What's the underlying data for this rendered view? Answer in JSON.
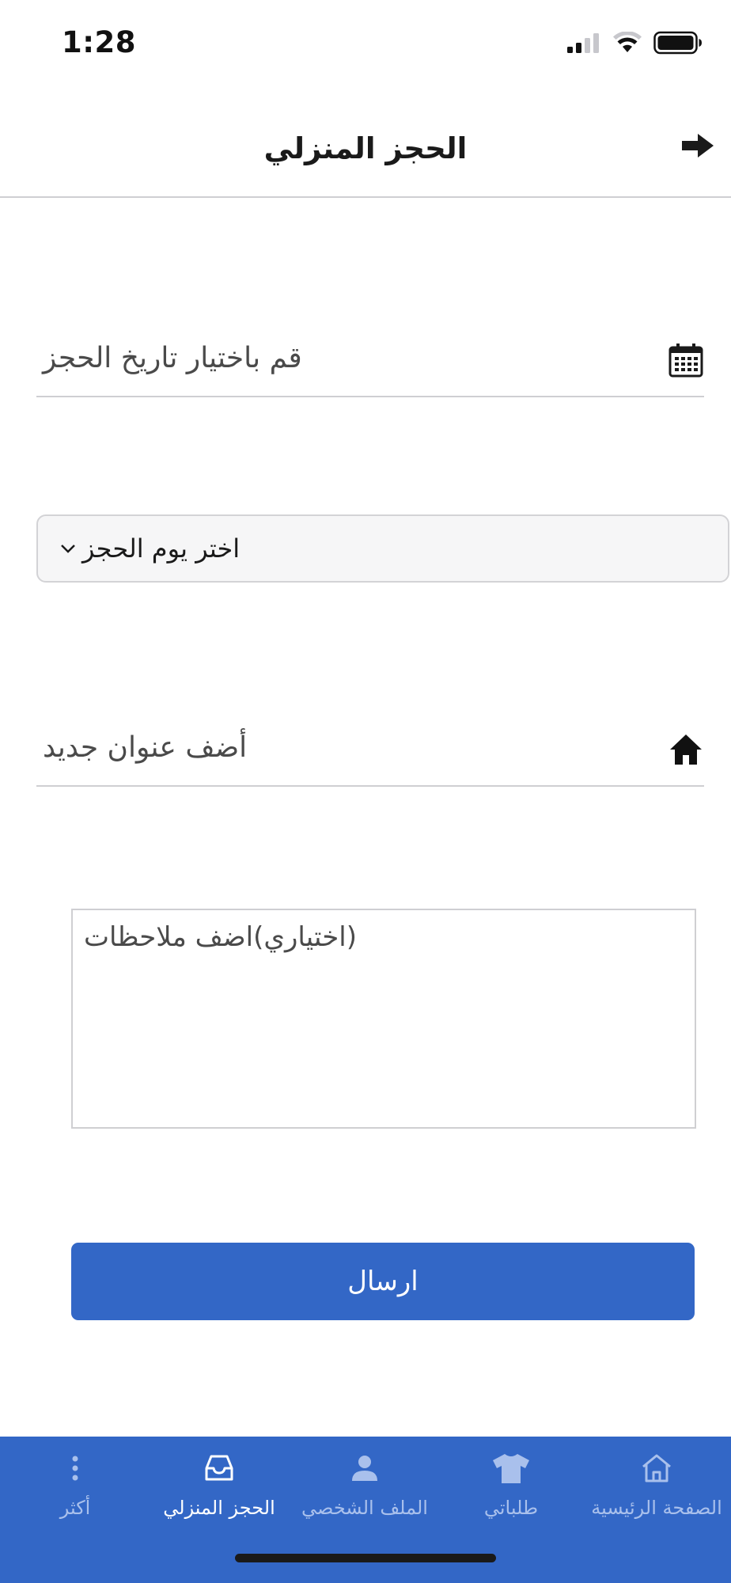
{
  "status_bar": {
    "time": "1:28",
    "icons": [
      "cellular-signal-icon",
      "wifi-icon",
      "battery-icon"
    ]
  },
  "header": {
    "title": "الحجز المنزلي",
    "back_icon": "arrow-right-icon"
  },
  "form": {
    "date_field": {
      "placeholder": "قم باختيار تاريخ الحجز",
      "icon": "calendar-icon"
    },
    "day_select": {
      "selected_label": "اختر يوم الحجز",
      "icon": "chevron-down-icon"
    },
    "address_field": {
      "placeholder": "أضف عنوان جديد",
      "icon": "home-filled-icon"
    },
    "notes": {
      "placeholder": "(اختياري)اضف ملاحظات"
    },
    "submit_label": "ارسال"
  },
  "bottom_nav": {
    "items": [
      {
        "label": "الصفحة الرئيسية",
        "icon": "home-outline-icon",
        "active": false
      },
      {
        "label": "طلباتي",
        "icon": "tshirt-icon",
        "active": false
      },
      {
        "label": "الملف الشخصي",
        "icon": "person-icon",
        "active": false
      },
      {
        "label": "الحجز المنزلي",
        "icon": "inbox-icon",
        "active": true
      },
      {
        "label": "أكثر",
        "icon": "more-vertical-icon",
        "active": false
      }
    ]
  },
  "colors": {
    "primary": "#3367c6",
    "nav_inactive_text": "#a9c0ec",
    "nav_active_text": "#ffffff",
    "divider": "#cfcfd2"
  }
}
